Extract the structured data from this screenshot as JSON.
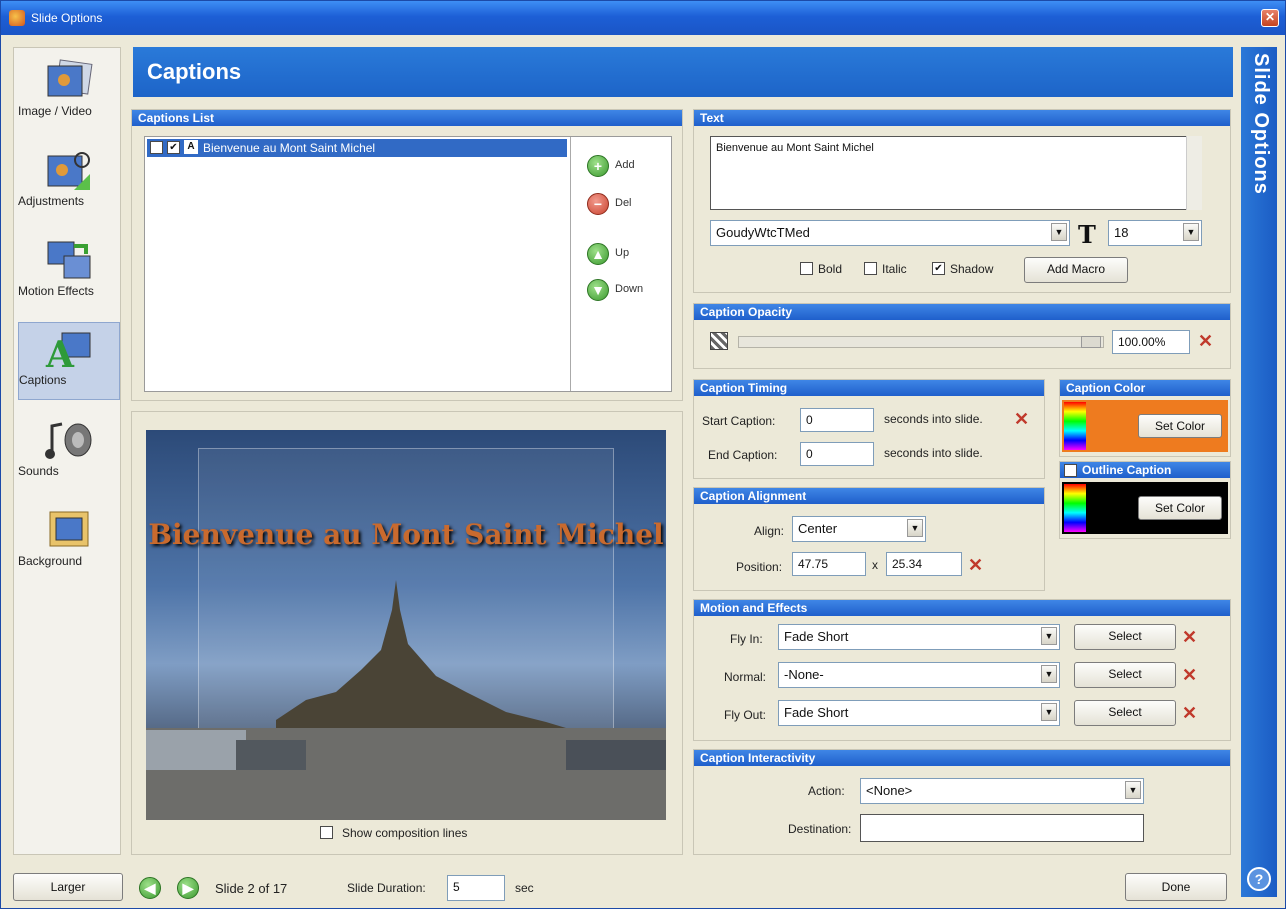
{
  "window": {
    "title": "Slide Options"
  },
  "nav": [
    {
      "label": "Image / Video",
      "icon": "image-video-icon"
    },
    {
      "label": "Adjustments",
      "icon": "adjustments-icon"
    },
    {
      "label": "Motion Effects",
      "icon": "motion-effects-icon"
    },
    {
      "label": "Captions",
      "icon": "captions-icon"
    },
    {
      "label": "Sounds",
      "icon": "sounds-icon"
    },
    {
      "label": "Background",
      "icon": "background-icon"
    }
  ],
  "header": {
    "title": "Captions"
  },
  "side_title": "Slide Options",
  "captions_list": {
    "heading": "Captions List",
    "items": [
      {
        "text": "Bienvenue au Mont Saint Michel",
        "checked": true
      }
    ],
    "buttons": {
      "add": "Add",
      "del": "Del",
      "up": "Up",
      "down": "Down"
    }
  },
  "preview": {
    "caption_overlay": "Bienvenue au Mont Saint Michel",
    "show_lines_label": "Show composition lines"
  },
  "text_panel": {
    "heading": "Text",
    "value": "Bienvenue au Mont Saint Michel",
    "font": "GoudyWtcTMed",
    "size": "18",
    "bold_label": "Bold",
    "italic_label": "Italic",
    "shadow_label": "Shadow",
    "shadow_checked": true,
    "add_macro": "Add Macro"
  },
  "opacity": {
    "heading": "Caption Opacity",
    "value": "100.00%",
    "level": 1.0
  },
  "timing": {
    "heading": "Caption Timing",
    "start_label": "Start Caption:",
    "start_value": "0",
    "end_label": "End Caption:",
    "end_value": "0",
    "suffix": "seconds into slide."
  },
  "color": {
    "heading": "Caption Color",
    "set_color": "Set Color",
    "swatch": "#ee7b1f"
  },
  "outline": {
    "heading": "Outline Caption",
    "set_color": "Set Color",
    "swatch": "#000000"
  },
  "alignment": {
    "heading": "Caption Alignment",
    "align_label": "Align:",
    "align_value": "Center",
    "position_label": "Position:",
    "x": "47.75",
    "times": "x",
    "y": "25.34"
  },
  "motion": {
    "heading": "Motion and Effects",
    "rows": [
      {
        "label": "Fly In:",
        "value": "Fade Short",
        "button": "Select"
      },
      {
        "label": "Normal:",
        "value": "-None-",
        "button": "Select"
      },
      {
        "label": "Fly Out:",
        "value": "Fade Short",
        "button": "Select"
      }
    ]
  },
  "interactivity": {
    "heading": "Caption Interactivity",
    "action_label": "Action:",
    "action_value": "<None>",
    "destination_label": "Destination:",
    "destination_value": ""
  },
  "footer": {
    "larger": "Larger",
    "slide_info": "Slide 2 of 17",
    "duration_label": "Slide Duration:",
    "duration_value": "5",
    "duration_unit": "sec",
    "done": "Done"
  }
}
